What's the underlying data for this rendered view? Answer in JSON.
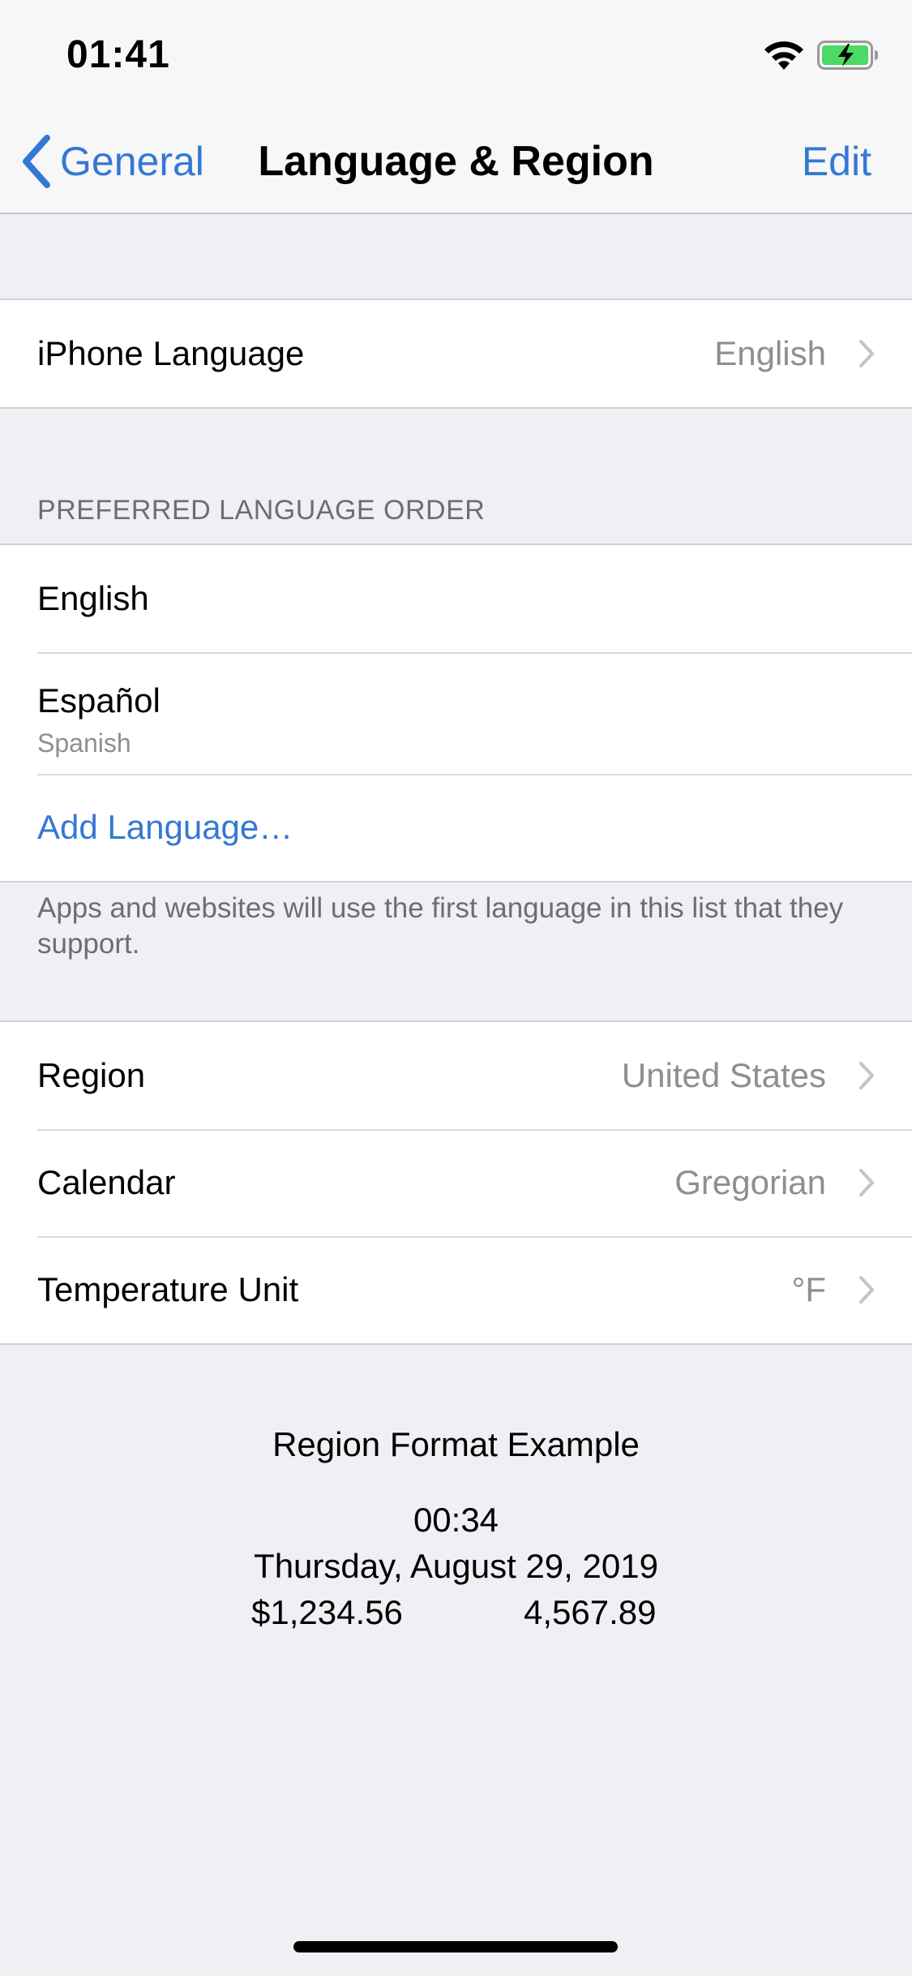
{
  "status_bar": {
    "time": "01:41",
    "icons": [
      "wifi-icon",
      "battery-charging-icon"
    ]
  },
  "nav": {
    "back_label": "General",
    "title": "Language & Region",
    "edit_label": "Edit"
  },
  "iphone_language": {
    "label": "iPhone Language",
    "value": "English"
  },
  "preferred": {
    "header": "PREFERRED LANGUAGE ORDER",
    "languages": [
      {
        "label": "English"
      },
      {
        "label": "Español",
        "subtitle": "Spanish"
      }
    ],
    "add_label": "Add Language…",
    "footer": "Apps and websites will use the first language in this list that they support."
  },
  "region_settings": [
    {
      "label": "Region",
      "value": "United States"
    },
    {
      "label": "Calendar",
      "value": "Gregorian"
    },
    {
      "label": "Temperature Unit",
      "value": "°F"
    }
  ],
  "format_example": {
    "title": "Region Format Example",
    "time": "00:34",
    "date": "Thursday, August 29, 2019",
    "currency": "$1,234.56",
    "number": "4,567.89"
  },
  "colors": {
    "accent": "#3478d4",
    "background": "#efeff4",
    "secondary_text": "#8e8e93",
    "battery_fill": "#4cd964"
  }
}
